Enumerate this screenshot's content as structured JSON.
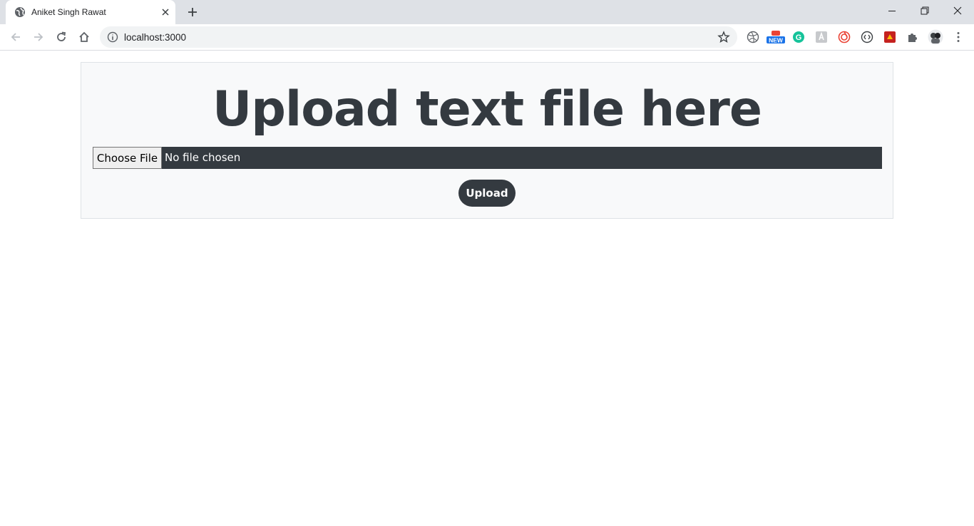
{
  "browser": {
    "tab_title": "Aniket Singh Rawat",
    "url": "localhost:3000",
    "extensions": [
      {
        "icon": "dribbble-like-icon"
      },
      {
        "icon": "new-badge-icon",
        "label": "NEW"
      },
      {
        "icon": "grammarly-icon",
        "label": "G"
      },
      {
        "icon": "extension-gray-icon"
      },
      {
        "icon": "spiral-extension-icon"
      },
      {
        "icon": "code-bracket-icon"
      },
      {
        "icon": "red-extension-icon"
      },
      {
        "icon": "puzzle-icon"
      },
      {
        "icon": "profile-avatar-icon"
      }
    ]
  },
  "page": {
    "heading": "Upload text file here",
    "file_input": {
      "button_label": "Choose File",
      "status": "No file chosen"
    },
    "upload_label": "Upload"
  },
  "colors": {
    "dark": "#343a40",
    "card_bg": "#f8f9fa",
    "card_border": "#dee2e6",
    "grammarly": "#15c39a",
    "new_badge": "#1a73e8"
  }
}
